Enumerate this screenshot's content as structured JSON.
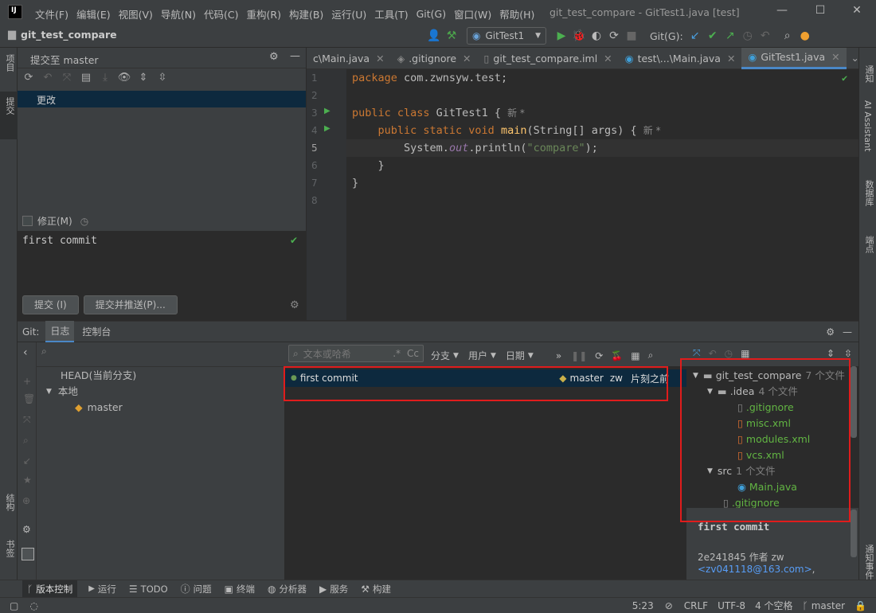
{
  "title_bar": {
    "menus": [
      "文件(F)",
      "编辑(E)",
      "视图(V)",
      "导航(N)",
      "代码(C)",
      "重构(R)",
      "构建(B)",
      "运行(U)",
      "工具(T)",
      "Git(G)",
      "窗口(W)",
      "帮助(H)"
    ],
    "window_title": "git_test_compare - GitTest1.java [test]"
  },
  "nav_bar": {
    "project_name": "git_test_compare",
    "run_config": "GitTest1",
    "git_label": "Git(G):"
  },
  "left_strip": {
    "project": "项目",
    "commit": "提交",
    "structure": "结构",
    "bookmarks": "书签"
  },
  "right_strip": {
    "notifications": "通知",
    "ai_assistant": "AI Assistant",
    "database": "数据库",
    "api": "端点",
    "maven": "通知事件"
  },
  "commit_panel": {
    "title": "提交至 master",
    "changes_label": "更改",
    "amend_label": "修正(M)",
    "message": "first commit",
    "commit_button": "提交 (I)",
    "commit_push_button": "提交并推送(P)..."
  },
  "editor": {
    "tabs": [
      {
        "label": "c\\Main.java",
        "icon": "java-class-icon"
      },
      {
        "label": ".gitignore",
        "icon": "gitignore-icon"
      },
      {
        "label": "git_test_compare.iml",
        "icon": "iml-file-icon"
      },
      {
        "label": "test\\...\\Main.java",
        "icon": "java-class-icon"
      },
      {
        "label": "GitTest1.java",
        "icon": "java-class-icon"
      }
    ],
    "line_numbers": [
      "1",
      "2",
      "3",
      "4",
      "5",
      "6",
      "7",
      "8"
    ],
    "hint_new": "新 *",
    "code": {
      "l1_kw": "package",
      "l1_rest": " com.zwnsyw.test;",
      "l3_kw": "public class",
      "l3_rest": " GitTest1 { ",
      "l4_kw": "public static void",
      "l4_fn": " main",
      "l4_rest": "(String[] args) { ",
      "l5_a": "System.",
      "l5_out": "out",
      "l5_b": ".println(",
      "l5_str": "\"compare\"",
      "l5_c": ");",
      "l6": "}",
      "l7": "}"
    }
  },
  "git_panel": {
    "label": "Git:",
    "tab_log": "日志",
    "tab_console": "控制台",
    "branch_tree": {
      "head": "HEAD(当前分支)",
      "local": "本地",
      "master": "master"
    },
    "filter": {
      "placeholder": "文本或哈希",
      "regex": ".*",
      "case": "Cc",
      "branch": "分支",
      "user": "用户",
      "date": "日期"
    },
    "commit_row": {
      "message": "first commit",
      "branch": "master",
      "author": "zw",
      "time": "片刻之前"
    },
    "files": {
      "root": "git_test_compare",
      "root_count": "7 个文件",
      "idea": ".idea",
      "idea_count": "4 个文件",
      "f1": ".gitignore",
      "f2": "misc.xml",
      "f3": "modules.xml",
      "f4": "vcs.xml",
      "src": "src",
      "src_count": "1 个文件",
      "f5": "Main.java",
      "f6": ".gitignore"
    },
    "details": {
      "message": "first commit",
      "hash_author": "2e241845 作者 zw",
      "email": "<zv041118@163.com>"
    }
  },
  "bottom_bar": [
    "版本控制",
    "运行",
    "TODO",
    "问题",
    "终端",
    "分析器",
    "服务",
    "构建"
  ],
  "status_bar": {
    "position": "5:23",
    "line_sep": "CRLF",
    "encoding": "UTF-8",
    "indent": "4 个空格",
    "branch": "master"
  }
}
